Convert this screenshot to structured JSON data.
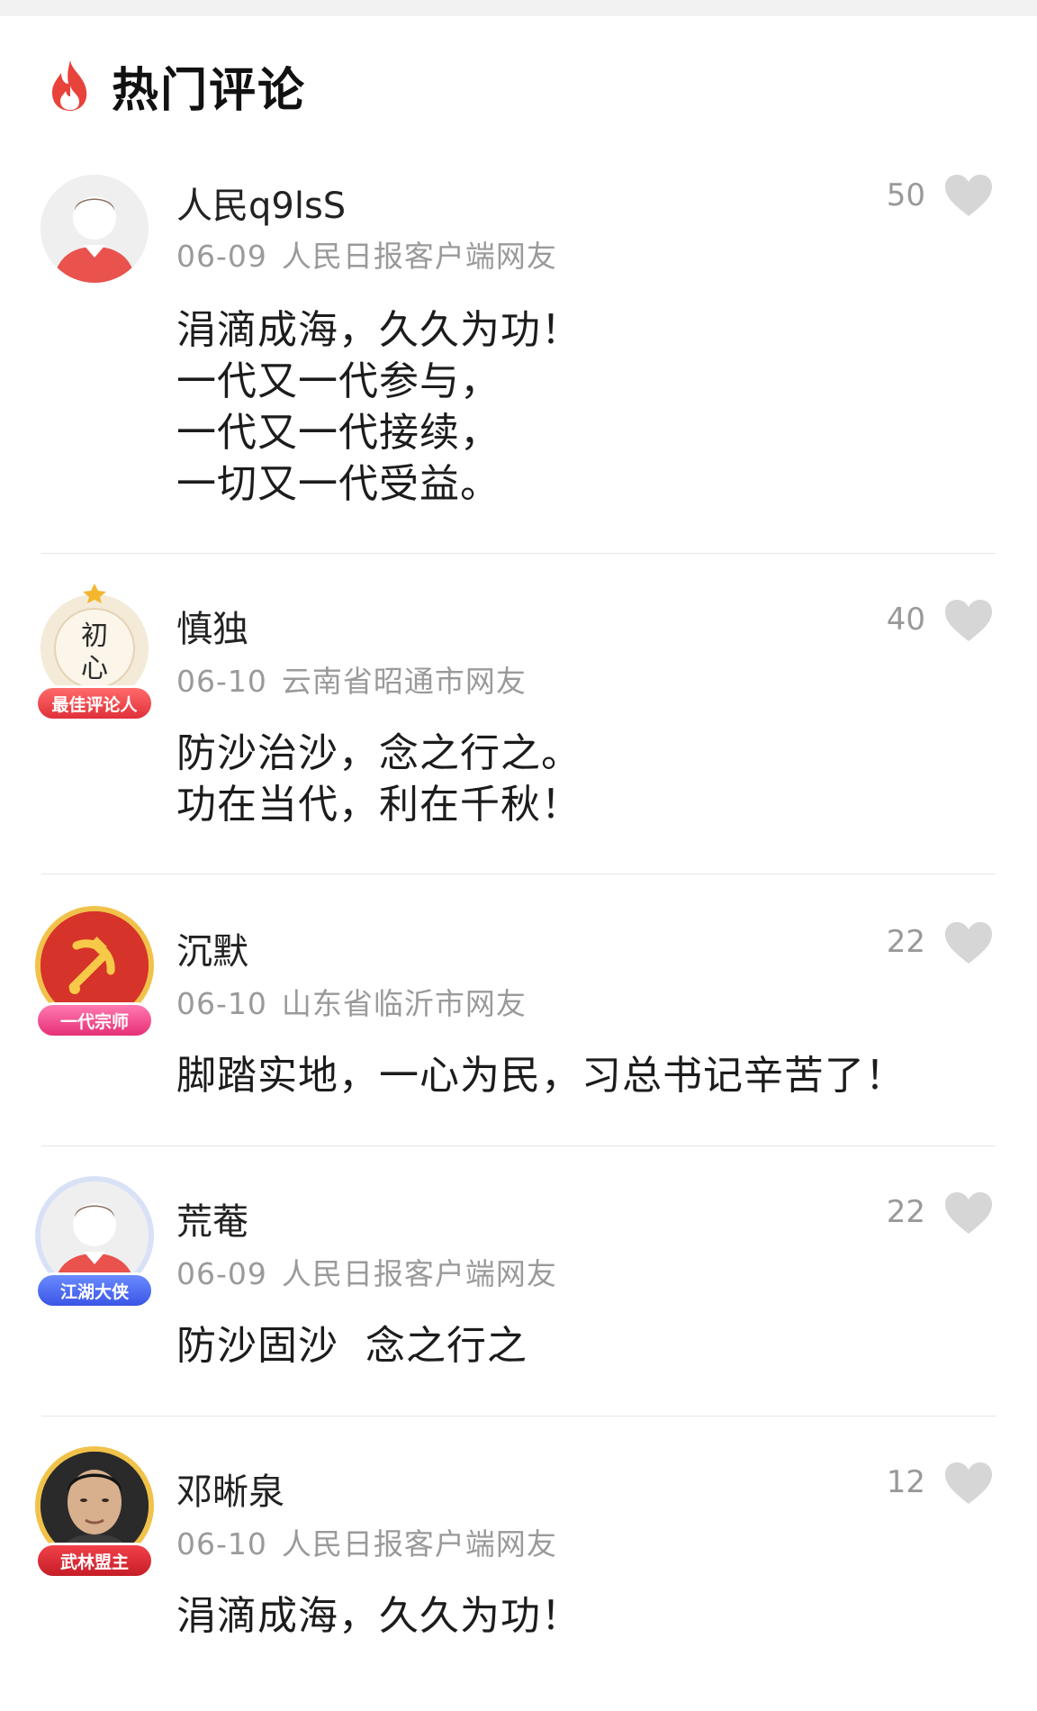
{
  "section": {
    "title": "热门评论",
    "icon": "flame-icon"
  },
  "comments": [
    {
      "username": "人民q9lsS",
      "date": "06-09",
      "source": "人民日报客户端网友",
      "likes": "50",
      "badge": "",
      "lines": [
        "涓滴成海，久久为功！",
        "一代又一代参与，",
        "一代又一代接续，",
        "一切又一代受益。"
      ]
    },
    {
      "username": "慎独",
      "date": "06-10",
      "source": "云南省昭通市网友",
      "likes": "40",
      "badge": "最佳评论人",
      "avatar_text": "初心",
      "lines": [
        "防沙治沙，念之行之。",
        "功在当代，利在千秋！"
      ]
    },
    {
      "username": "沉默",
      "date": "06-10",
      "source": "山东省临沂市网友",
      "likes": "22",
      "badge": "一代宗师",
      "lines": [
        "脚踏实地，一心为民，习总书记辛苦了！"
      ]
    },
    {
      "username": "荒菴",
      "date": "06-09",
      "source": "人民日报客户端网友",
      "likes": "22",
      "badge": "江湖大侠",
      "lines": [
        "防沙固沙  念之行之"
      ]
    },
    {
      "username": "邓晰泉",
      "date": "06-10",
      "source": "人民日报客户端网友",
      "likes": "12",
      "badge": "武林盟主",
      "lines": [
        "涓滴成海，久久为功！"
      ]
    }
  ],
  "colors": {
    "like_icon": "#d6d6d6",
    "meta_text": "#9a9a9a",
    "flame": "#e8433b"
  }
}
